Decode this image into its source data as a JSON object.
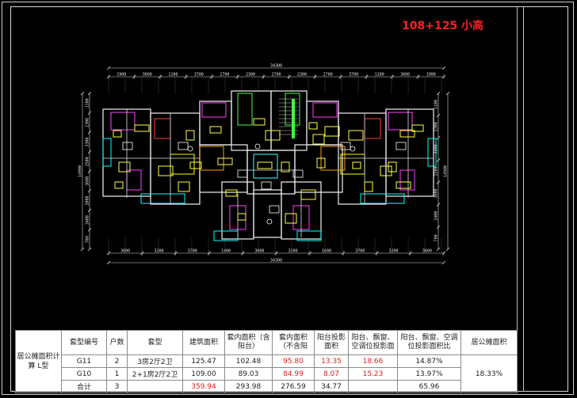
{
  "title": "108+125 小高",
  "dimensions": {
    "overall_top": "34300",
    "overall_bottom": "34300",
    "top_segments": [
      "1900",
      "3600",
      "1100",
      "3700",
      "2700",
      "2300",
      "2700",
      "2300",
      "2700",
      "3700",
      "1100",
      "3600",
      "1900"
    ],
    "bottom_segments": [
      "3600",
      "3200",
      "3700",
      "1400",
      "3600",
      "3200",
      "1600",
      "3700",
      "3200",
      "3600"
    ],
    "left_segments": [
      "1100",
      "2300",
      "3300",
      "2500",
      "3600",
      "2000",
      "3400",
      "700"
    ],
    "left_overall": "14900",
    "right_segments": [
      "1100",
      "2300",
      "3300",
      "2500",
      "3600",
      "3400",
      "700"
    ],
    "right_overall": "14900"
  },
  "table": {
    "row_label": "居公摊面积计算 L型",
    "headers": [
      "套型编号",
      "户数",
      "套型",
      "建筑面积",
      "套内面积（含阳台）",
      "套内面积（不含阳",
      "阳台投影面积",
      "阳台、飘窗、空调位投影面",
      "阳台、飘窗、空调位投影面积比",
      "居公摊面积"
    ],
    "rows": [
      {
        "code": "G11",
        "households": "2",
        "type": "3房2厅2卫",
        "gross": "125.47",
        "inner_with": "102.48",
        "inner_without": "95.80",
        "balcony": "13.35",
        "proj": "18.66",
        "ratio": "14.87%"
      },
      {
        "code": "G10",
        "households": "1",
        "type": "2+1房2厅2卫",
        "gross": "109.00",
        "inner_with": "89.03",
        "inner_without": "84.99",
        "balcony": "8.07",
        "proj": "15.23",
        "ratio": "13.97%"
      }
    ],
    "total": {
      "label": "合计",
      "households": "3",
      "type": "",
      "gross": "359.94",
      "inner_with": "293.98",
      "inner_without": "276.59",
      "balcony": "34.77",
      "proj": "",
      "ratio": "65.96"
    },
    "shared": "18.33%"
  }
}
